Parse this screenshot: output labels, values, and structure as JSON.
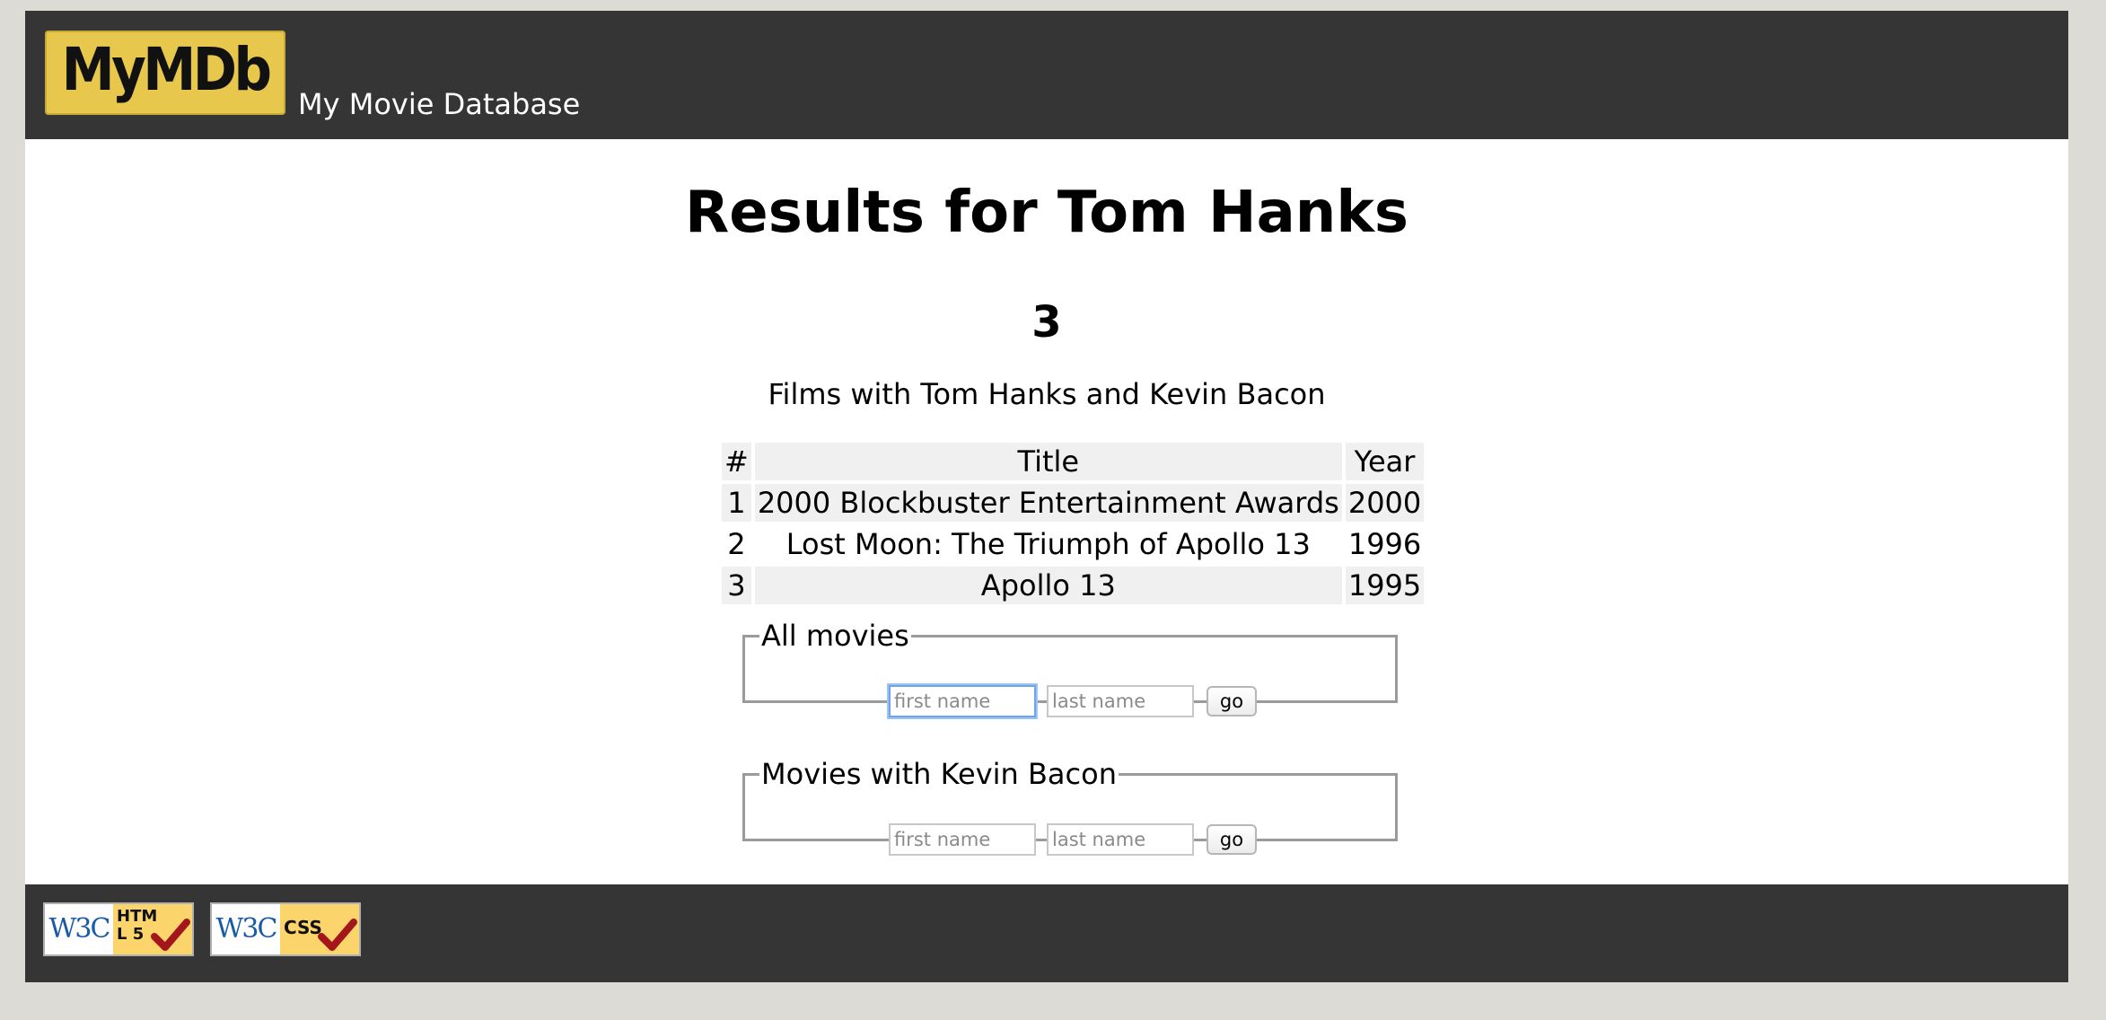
{
  "header": {
    "logo_text": "MyMDb",
    "site_name": "My Movie Database"
  },
  "main": {
    "title": "Results for Tom Hanks",
    "count": "3",
    "caption": "Films with Tom Hanks and Kevin Bacon",
    "table": {
      "columns": [
        "#",
        "Title",
        "Year"
      ],
      "rows": [
        {
          "num": "1",
          "title": "2000 Blockbuster Entertainment Awards",
          "year": "2000"
        },
        {
          "num": "2",
          "title": "Lost Moon: The Triumph of Apollo 13",
          "year": "1996"
        },
        {
          "num": "3",
          "title": "Apollo 13",
          "year": "1995"
        }
      ]
    }
  },
  "forms": {
    "all_movies": {
      "legend": "All movies",
      "first_placeholder": "first name",
      "last_placeholder": "last name",
      "button": "go"
    },
    "bacon_movies": {
      "legend": "Movies with Kevin Bacon",
      "first_placeholder": "first name",
      "last_placeholder": "last name",
      "button": "go"
    }
  },
  "footer": {
    "badges": [
      {
        "logo": "W3C",
        "label": "HTML 5",
        "icon": "check-icon"
      },
      {
        "logo": "W3C",
        "label": "CSS",
        "icon": "check-icon"
      }
    ]
  },
  "colors": {
    "banner": "#353535",
    "logo_bg": "#e8c84c",
    "page_bg": "#dcdbd6",
    "row_shade": "#f0f0f0",
    "focus_ring": "#6ea4ea"
  }
}
